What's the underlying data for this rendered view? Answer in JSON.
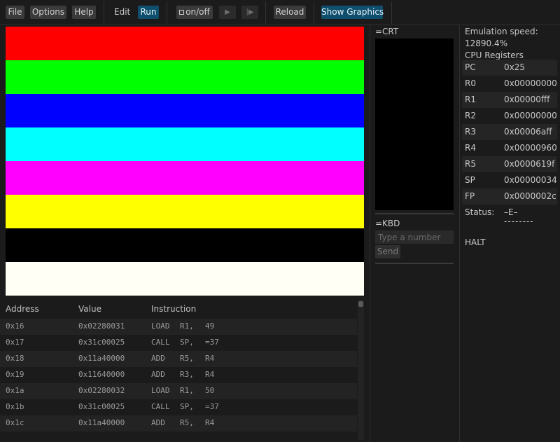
{
  "toolbar": {
    "file": "File",
    "options": "Options",
    "help": "Help",
    "edit": "Edit",
    "run": "Run",
    "onoff": "on/off",
    "play_icon": "▶",
    "step_icon": "|▶",
    "reload": "Reload",
    "show_graphics": "Show Graphics"
  },
  "graphics": {
    "stripes": [
      "#ff0000",
      "#00ff00",
      "#0000ff",
      "#00ffff",
      "#ff00ff",
      "#ffff00",
      "#000000",
      "#fffff5"
    ]
  },
  "memory": {
    "headers": {
      "address": "Address",
      "value": "Value",
      "instruction": "Instruction"
    },
    "rows": [
      {
        "address": "0x16",
        "value": "0x02280031",
        "op": "LOAD",
        "arg1": "R1,",
        "arg2": "49"
      },
      {
        "address": "0x17",
        "value": "0x31c00025",
        "op": "CALL",
        "arg1": "SP,",
        "arg2": "=37"
      },
      {
        "address": "0x18",
        "value": "0x11a40000",
        "op": "ADD",
        "arg1": "R5,",
        "arg2": "R4"
      },
      {
        "address": "0x19",
        "value": "0x11640000",
        "op": "ADD",
        "arg1": "R3,",
        "arg2": "R4"
      },
      {
        "address": "0x1a",
        "value": "0x02280032",
        "op": "LOAD",
        "arg1": "R1,",
        "arg2": "50"
      },
      {
        "address": "0x1b",
        "value": "0x31c00025",
        "op": "CALL",
        "arg1": "SP,",
        "arg2": "=37"
      },
      {
        "address": "0x1c",
        "value": "0x11a40000",
        "op": "ADD",
        "arg1": "R5,",
        "arg2": "R4"
      }
    ]
  },
  "crt": {
    "label": "=CRT"
  },
  "kbd": {
    "label": "=KBD",
    "placeholder": "Type a number",
    "send": "Send"
  },
  "cpu": {
    "speed_label": "Emulation speed:",
    "speed_value": "12890.4%",
    "registers_title": "CPU Registers",
    "registers": [
      {
        "name": "PC",
        "value": "0x25"
      },
      {
        "name": "R0",
        "value": "0x00000000"
      },
      {
        "name": "R1",
        "value": "0x00000fff"
      },
      {
        "name": "R2",
        "value": "0x00000000"
      },
      {
        "name": "R3",
        "value": "0x00006aff"
      },
      {
        "name": "R4",
        "value": "0x00000960"
      },
      {
        "name": "R5",
        "value": "0x0000619f"
      },
      {
        "name": "SP",
        "value": "0x00000034"
      },
      {
        "name": "FP",
        "value": "0x0000002c"
      }
    ],
    "status_label": "Status:",
    "status_flags": "–E–",
    "status_dashes": "--------",
    "state": "HALT"
  }
}
